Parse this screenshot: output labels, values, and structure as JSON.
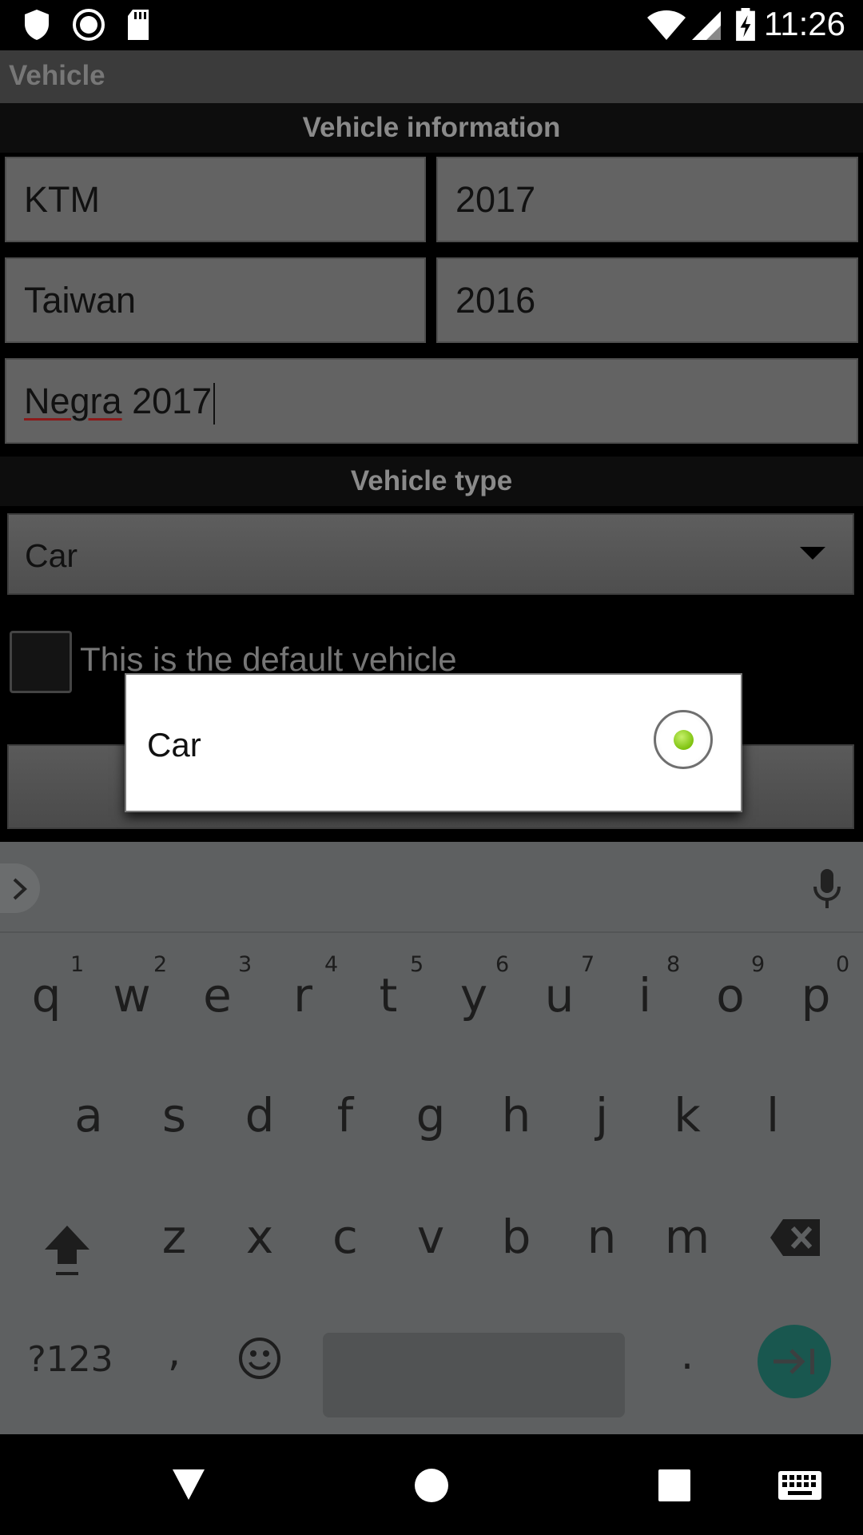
{
  "status_bar": {
    "time": "11:26",
    "left_icons": [
      "shield-icon",
      "record-icon",
      "sd-card-icon"
    ],
    "right_icons": [
      "wifi-icon",
      "cell-signal-icon",
      "battery-charging-icon"
    ]
  },
  "action_bar": {
    "title": "Vehicle"
  },
  "vehicle_information": {
    "header": "Vehicle information",
    "brand": "KTM",
    "year": "2017",
    "origin": "Taiwan",
    "purchase_year": "2016",
    "name_misspelled": "Negra",
    "name_rest": " 2017"
  },
  "vehicle_type": {
    "header": "Vehicle type",
    "selected": "Car"
  },
  "default_vehicle": {
    "label": "This is the default vehicle",
    "checked": false
  },
  "dialog": {
    "option_label": "Car",
    "option_selected": true,
    "accent_color": "#8bd42a"
  },
  "keyboard": {
    "row1": [
      "q",
      "w",
      "e",
      "r",
      "t",
      "y",
      "u",
      "i",
      "o",
      "p"
    ],
    "row1_hints": [
      "1",
      "2",
      "3",
      "4",
      "5",
      "6",
      "7",
      "8",
      "9",
      "0"
    ],
    "row2": [
      "a",
      "s",
      "d",
      "f",
      "g",
      "h",
      "j",
      "k",
      "l"
    ],
    "row3": [
      "z",
      "x",
      "c",
      "v",
      "b",
      "n",
      "m"
    ],
    "symbols_label": "?123",
    "comma": ",",
    "period": ".",
    "enter_color": "#19574f"
  },
  "nav_bar": {
    "icons": [
      "back-icon",
      "home-icon",
      "recents-icon",
      "keyboard-switch-icon"
    ]
  }
}
